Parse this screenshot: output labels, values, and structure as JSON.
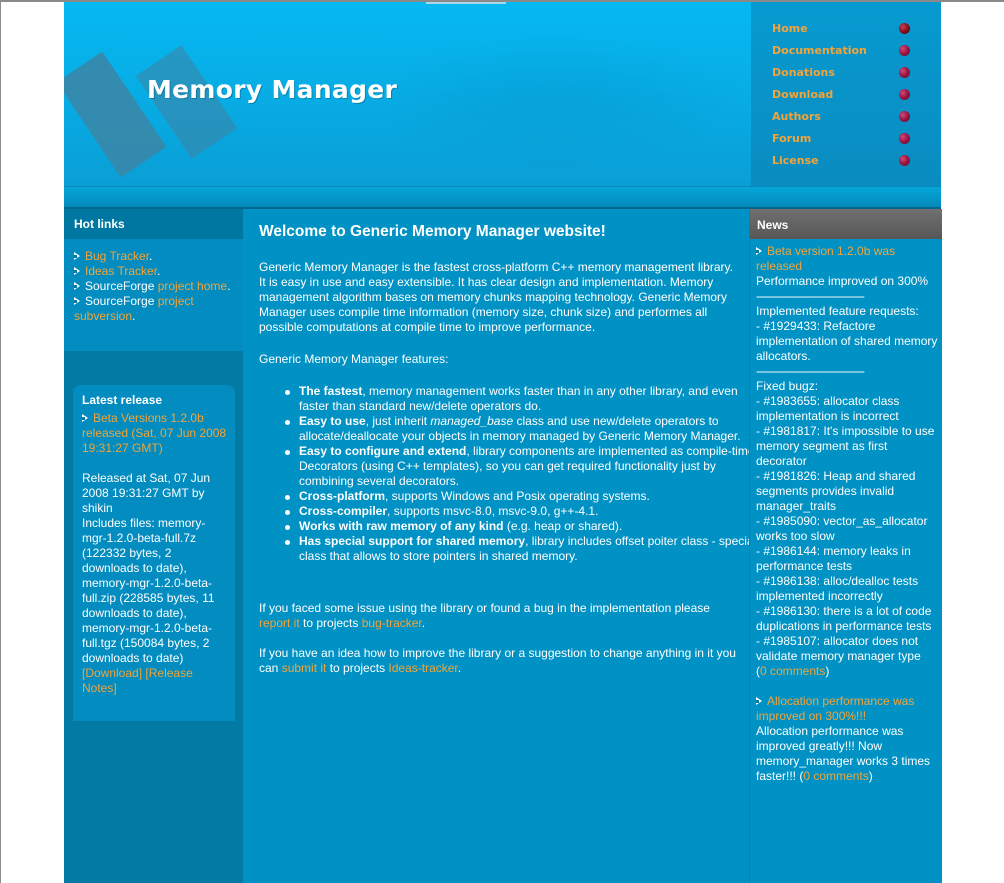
{
  "site": {
    "title": "Memory Manager"
  },
  "nav": {
    "items": [
      {
        "label": "Home",
        "active": true
      },
      {
        "label": "Documentation"
      },
      {
        "label": "Donations"
      },
      {
        "label": "Download"
      },
      {
        "label": "Authors"
      },
      {
        "label": "Forum"
      },
      {
        "label": "License"
      }
    ]
  },
  "hot_links": {
    "title": "Hot links",
    "items": [
      {
        "prefix": "",
        "link": "Bug Tracker",
        "suffix": "."
      },
      {
        "prefix": "",
        "link": "Ideas Tracker",
        "suffix": "."
      },
      {
        "prefix": "SourceForge ",
        "link": "project home",
        "suffix": "."
      },
      {
        "prefix": "SourceForge ",
        "link": "project subversion",
        "suffix": "."
      }
    ]
  },
  "latest_release": {
    "title": "Latest release",
    "headline": "Beta Versions 1.2.0b released (Sat, 07 Jun 2008 19:31:27 GMT)",
    "body": "Released at Sat, 07 Jun 2008 19:31:27 GMT by shikin",
    "files": "Includes files: memory-mgr-1.2.0-beta-full.7z (122332 bytes, 2 downloads to date), memory-mgr-1.2.0-beta-full.zip (228585 bytes, 11 downloads to date), memory-mgr-1.2.0-beta-full.tgz (150084 bytes, 2 downloads to date)",
    "download_link": "[Download]",
    "notes_link": "[Release Notes]"
  },
  "main": {
    "heading": "Welcome to Generic Memory Manager website!",
    "intro": "Generic Memory Manager is the fastest cross-platform C++ memory management library. It is easy in use and easy extensible. It has clear design and implementation. Memory management algorithm bases on memory chunks mapping technology. Generic Memory Manager uses compile time information (memory size, chunk size) and performes all possible computations at compile time to improve performance.",
    "features_title": "Generic Memory Manager features:",
    "features": [
      {
        "bold": "The fastest",
        "text": ", memory management works faster than in any other library, and even faster than standard new/delete operators do."
      },
      {
        "bold": "Easy to use",
        "text": ", just inherit ",
        "italic": "managed_base",
        "text2": " class and use new/delete operators to allocate/deallocate your objects in memory managed by Generic Memory Manager."
      },
      {
        "bold": "Easy to configure and extend",
        "text": ", library components are implemented as compile-time Decorators (using C++ templates), so you can get required functionality just by combining several decorators."
      },
      {
        "bold": "Cross-platform",
        "text": ", supports Windows and Posix operating systems."
      },
      {
        "bold": "Cross-compiler",
        "text": ", supports msvc-8.0, msvc-9.0, g++-4.1."
      },
      {
        "bold": "Works with raw memory of any kind",
        "text": " (e.g. heap or shared)."
      },
      {
        "bold": "Has special support for shared memory",
        "text": ", library includes offset poiter class - special class that allows to store pointers in shared memory."
      }
    ],
    "bug_para": {
      "t1": "If you faced some issue using the library or found a bug in the implementation please ",
      "l1": "report it",
      "t2": " to projects ",
      "l2": "bug-tracker",
      "t3": "."
    },
    "idea_para": {
      "t1": "If you have an idea how to improve the library or a suggestion to change anything in it you can ",
      "l1": "submit it",
      "t2": " to projects ",
      "l2": "Ideas-tracker",
      "t3": "."
    }
  },
  "news": {
    "title": "News",
    "item1": {
      "headline": "Beta version 1.2.0b was released",
      "summary": "Performance improved on 300%",
      "divider": "------------------------------------",
      "features_title": "Implemented feature requests:",
      "features": "- #1929433: Refactore implementation of shared memory allocators.",
      "bugs_title": "Fixed bugz:",
      "bugs": [
        "- #1983655: allocator class implementation is incorrect",
        "- #1981817: It's impossible to use memory segment as first decorator",
        "- #1981826: Heap and shared segments provides invalid manager_traits",
        "- #1985090: vector_as_allocator works too slow",
        "- #1986144: memory leaks in performance tests",
        "- #1986138: alloc/dealloc tests implemented incorrectly",
        "- #1986130: there is a lot of code duplications in performance tests",
        "- #1985107: allocator does not validate memory manager type"
      ],
      "comments": "0 comments"
    },
    "item2": {
      "headline": "Allocation performance was improved on 300%!!!",
      "body": "Allocation performance was improved greatly!!! Now memory_manager works 3 times faster!!! ",
      "comments": "0 comments"
    }
  },
  "colors": {
    "page_bg": "#0092c4",
    "link": "#f2a43a",
    "left_column": "#027aa4",
    "news_header": "#666666"
  }
}
